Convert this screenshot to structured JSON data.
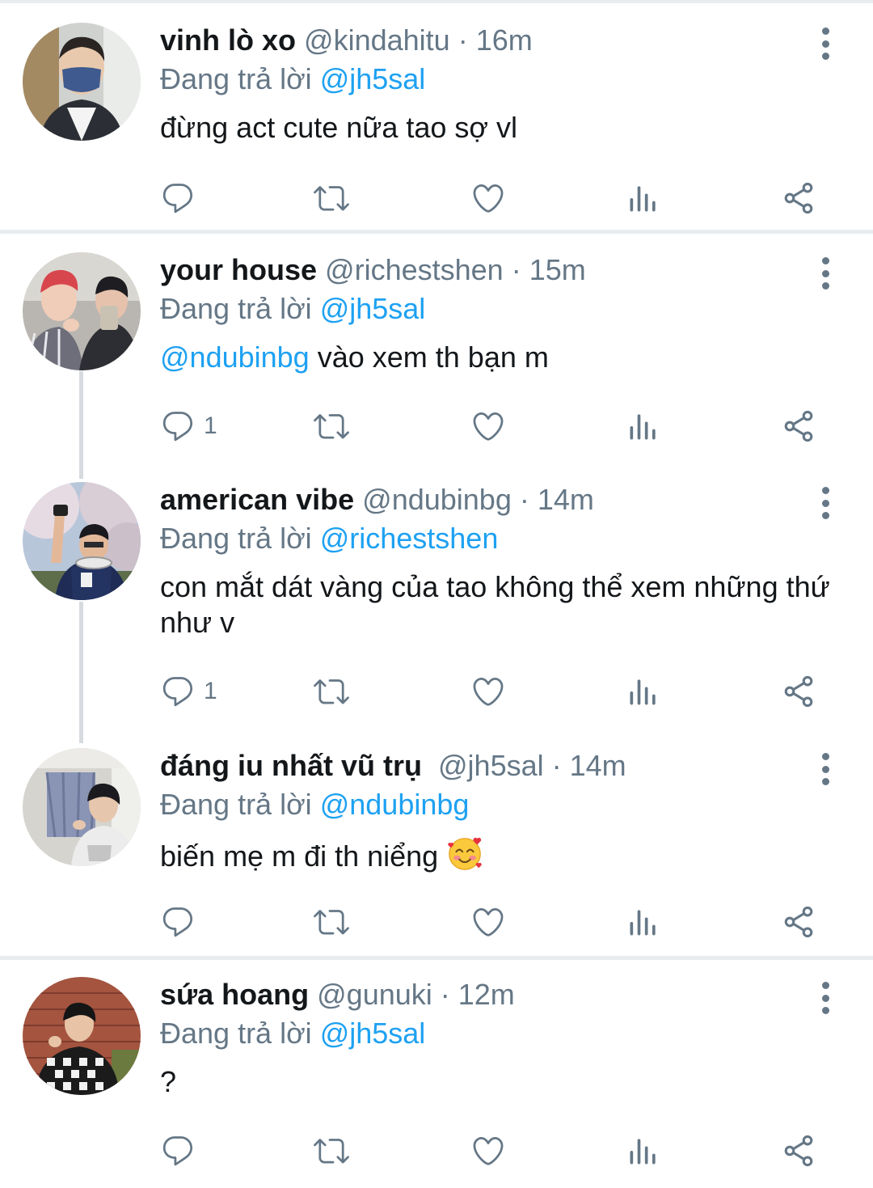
{
  "reply_prefix": "Đang trả lời",
  "colors": {
    "link": "#1da1f2",
    "secondary": "#657786",
    "text": "#14171a",
    "divider": "#e8ecef"
  },
  "icons": [
    "reply-icon",
    "retweet-icon",
    "like-icon",
    "analytics-icon",
    "share-icon",
    "more-options-icon"
  ],
  "tweets": [
    {
      "name": "vinh lò xo",
      "handle": "@kindahitu",
      "time": "16m",
      "reply_to": "@jh5sal",
      "text": "đừng act cute nữa tao sợ vl",
      "reply_count": ""
    },
    {
      "name": "your house",
      "handle": "@richestshen",
      "time": "15m",
      "reply_to": "@jh5sal",
      "text_mention": "@ndubinbg",
      "text": "vào xem th bạn m",
      "reply_count": "1"
    },
    {
      "name": "american vibe",
      "handle": "@ndubinbg",
      "time": "14m",
      "reply_to": "@richestshen",
      "text": "con mắt dát vàng của tao không thể xem những thứ như v",
      "reply_count": "1"
    },
    {
      "name": "đáng iu nhất vũ trụ",
      "handle": "@jh5sal",
      "time": "14m",
      "reply_to": "@ndubinbg",
      "text": "biến mẹ m đi th niểng",
      "emoji": "smiling-face-with-hearts",
      "reply_count": ""
    },
    {
      "name": "sứa hoang",
      "handle": "@gunuki",
      "time": "12m",
      "reply_to": "@jh5sal",
      "text": "?",
      "reply_count": ""
    }
  ]
}
